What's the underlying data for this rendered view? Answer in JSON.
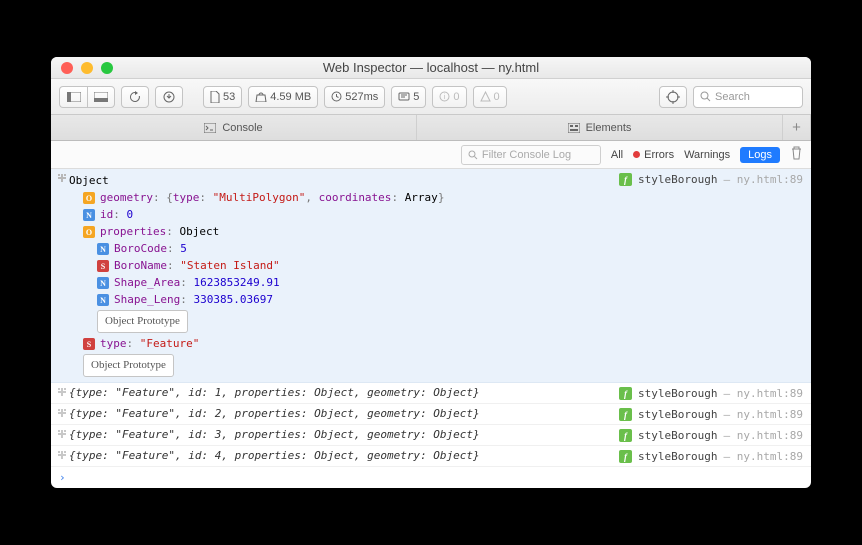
{
  "window_title": "Web Inspector — localhost — ny.html",
  "toolbar": {
    "resources": "53",
    "size": "4.59 MB",
    "time": "527ms",
    "messages": "5",
    "warnings": "0",
    "errors": "0",
    "search_placeholder": "Search"
  },
  "tabs": {
    "console": "Console",
    "elements": "Elements"
  },
  "filter": {
    "placeholder": "Filter Console Log",
    "all": "All",
    "errors": "Errors",
    "warnings": "Warnings",
    "logs": "Logs"
  },
  "source": {
    "func": "styleBorough",
    "loc": "ny.html:89"
  },
  "expanded": {
    "head": "Object",
    "geometry_key": "geometry",
    "type_key": "type",
    "multipoly": "\"MultiPolygon\"",
    "coords_key": "coordinates",
    "arr": "Array",
    "id_key": "id",
    "id_val": "0",
    "props_key": "properties",
    "props_val": "Object",
    "boroCode_k": "BoroCode",
    "boroCode_v": "5",
    "boroName_k": "BoroName",
    "boroName_v": "\"Staten Island\"",
    "area_k": "Shape_Area",
    "area_v": "1623853249.91",
    "leng_k": "Shape_Leng",
    "leng_v": "330385.03697",
    "proto": "Object Prototype",
    "feat_type_k": "type",
    "feat_type_v": "\"Feature\""
  },
  "rows": [
    {
      "type": "\"Feature\"",
      "id": "1",
      "props": "Object",
      "geom": "Object"
    },
    {
      "type": "\"Feature\"",
      "id": "2",
      "props": "Object",
      "geom": "Object"
    },
    {
      "type": "\"Feature\"",
      "id": "3",
      "props": "Object",
      "geom": "Object"
    },
    {
      "type": "\"Feature\"",
      "id": "4",
      "props": "Object",
      "geom": "Object"
    }
  ]
}
